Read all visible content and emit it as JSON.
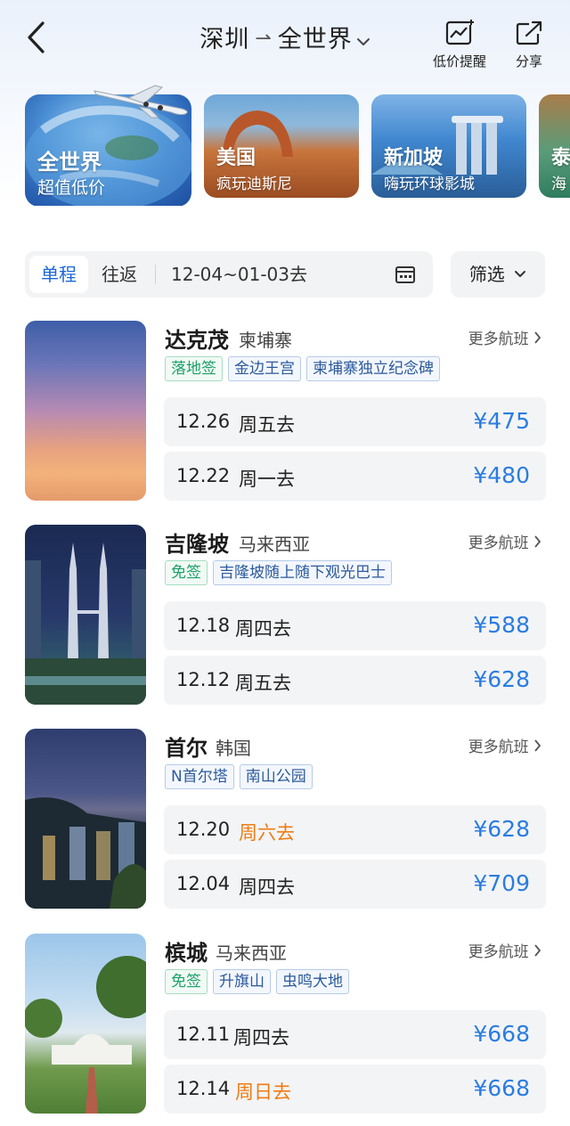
{
  "header": {
    "origin": "深圳",
    "route_arrow": "⇀",
    "destination": "全世界",
    "price_alert_label": "低价提醒",
    "share_label": "分享"
  },
  "destinations": [
    {
      "name": "全世界",
      "subtitle": "超值低价"
    },
    {
      "name": "美国",
      "subtitle": "疯玩迪斯尼"
    },
    {
      "name": "新加坡",
      "subtitle": "嗨玩环球影城"
    },
    {
      "name": "泰",
      "subtitle": "海"
    }
  ],
  "filter": {
    "tab_oneway": "单程",
    "tab_roundtrip": "往返",
    "date_range": "12-04~01-03去",
    "filter_label": "筛选"
  },
  "results": [
    {
      "city": "达克茂",
      "country": "柬埔寨",
      "more": "更多航班",
      "tags": [
        {
          "text": "落地签",
          "style": "green"
        },
        {
          "text": "金边王宫",
          "style": "blue"
        },
        {
          "text": "柬埔寨独立纪念碑",
          "style": "blue"
        }
      ],
      "flights": [
        {
          "date": "12.26",
          "weekday": "周五去",
          "weekend": false,
          "price": "¥475"
        },
        {
          "date": "12.22",
          "weekday": "周一去",
          "weekend": false,
          "price": "¥480"
        }
      ]
    },
    {
      "city": "吉隆坡",
      "country": "马来西亚",
      "more": "更多航班",
      "tags": [
        {
          "text": "免签",
          "style": "green"
        },
        {
          "text": "吉隆坡随上随下观光巴士",
          "style": "blue"
        }
      ],
      "flights": [
        {
          "date": "12.18",
          "weekday": "周四去",
          "weekend": false,
          "price": "¥588"
        },
        {
          "date": "12.12",
          "weekday": "周五去",
          "weekend": false,
          "price": "¥628"
        }
      ]
    },
    {
      "city": "首尔",
      "country": "韩国",
      "more": "更多航班",
      "tags": [
        {
          "text": "N首尔塔",
          "style": "blue"
        },
        {
          "text": "南山公园",
          "style": "blue"
        }
      ],
      "flights": [
        {
          "date": "12.20",
          "weekday": "周六去",
          "weekend": true,
          "price": "¥628"
        },
        {
          "date": "12.04",
          "weekday": "周四去",
          "weekend": false,
          "price": "¥709"
        }
      ]
    },
    {
      "city": "槟城",
      "country": "马来西亚",
      "more": "更多航班",
      "tags": [
        {
          "text": "免签",
          "style": "green"
        },
        {
          "text": "升旗山",
          "style": "blue"
        },
        {
          "text": "虫鸣大地",
          "style": "blue"
        }
      ],
      "flights": [
        {
          "date": "12.11",
          "weekday": "周四去",
          "weekend": false,
          "price": "¥668"
        },
        {
          "date": "12.14",
          "weekday": "周日去",
          "weekend": true,
          "price": "¥668"
        }
      ]
    }
  ]
}
